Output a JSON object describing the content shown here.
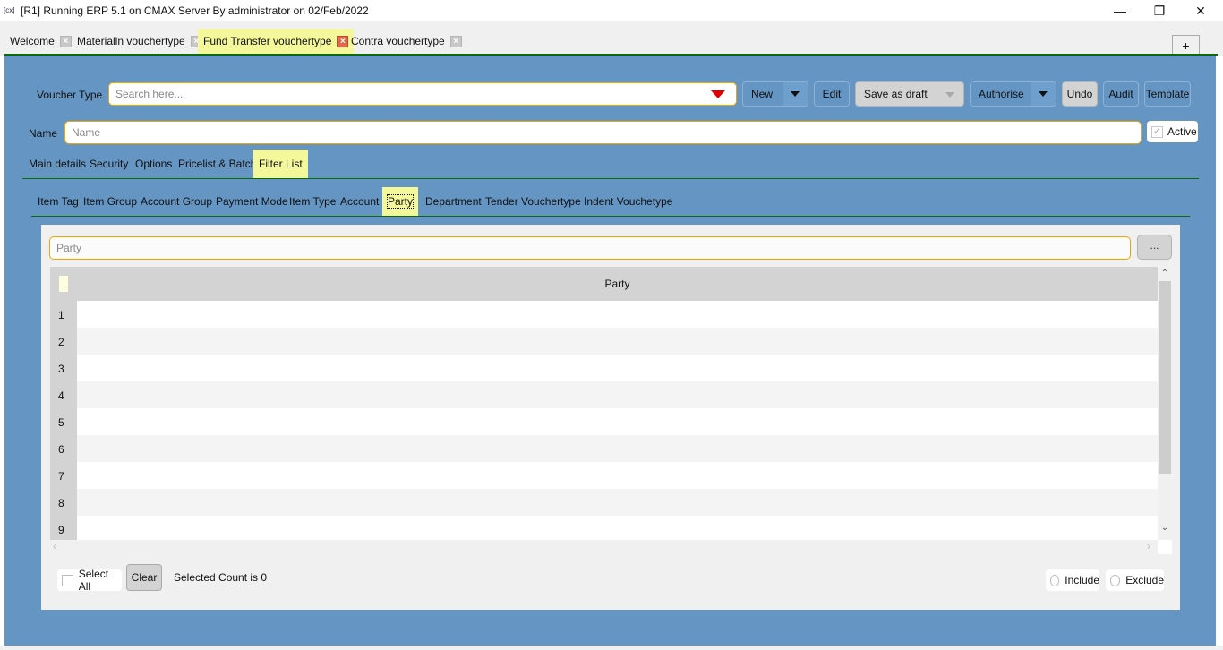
{
  "window": {
    "app_icon": "[cx]",
    "title": "[R1] Running ERP 5.1 on CMAX Server By administrator on 02/Feb/2022",
    "controls": {
      "minimize": "—",
      "restore": "❐",
      "close": "✕"
    }
  },
  "doc_tabs": [
    {
      "label": "Welcome",
      "active": false
    },
    {
      "label": "Materialln vouchertype",
      "active": false
    },
    {
      "label": "Fund Transfer vouchertype",
      "active": true
    },
    {
      "label": "Contra vouchertype",
      "active": false
    }
  ],
  "new_tab_label": "+",
  "toolbar": {
    "voucher_type_label": "Voucher Type",
    "voucher_type_placeholder": "Search here...",
    "new_label": "New",
    "edit_label": "Edit",
    "save_as_draft_label": "Save as draft",
    "authorise_label": "Authorise",
    "undo_label": "Undo",
    "audit_label": "Audit",
    "template_label": "Template"
  },
  "name_field": {
    "label": "Name",
    "placeholder": "Name"
  },
  "active_checkbox": {
    "label": "Active",
    "checked": true,
    "check_glyph": "✓"
  },
  "main_tabs": [
    {
      "label": "Main details",
      "active": false
    },
    {
      "label": "Security",
      "active": false
    },
    {
      "label": "Options",
      "active": false
    },
    {
      "label": "Pricelist & Batch",
      "active": false
    },
    {
      "label": "Filter List",
      "active": true
    }
  ],
  "filter_tabs": [
    {
      "label": "Item Tag",
      "active": false
    },
    {
      "label": "Item Group",
      "active": false
    },
    {
      "label": "Account Group",
      "active": false
    },
    {
      "label": "Payment Mode",
      "active": false
    },
    {
      "label": "Item Type",
      "active": false
    },
    {
      "label": "Account",
      "active": false
    },
    {
      "label": "Party",
      "active": true
    },
    {
      "label": "Department",
      "active": false
    },
    {
      "label": "Tender Vouchertype",
      "active": false
    },
    {
      "label": "Indent Vouchetype",
      "active": false
    }
  ],
  "party_panel": {
    "search_placeholder": "Party",
    "browse_label": "...",
    "column_header": "Party",
    "rows": [
      "1",
      "2",
      "3",
      "4",
      "5",
      "6",
      "7",
      "8",
      "9"
    ],
    "scroll_up": "⌃",
    "scroll_down": "⌄",
    "scroll_left": "‹",
    "scroll_right": "›",
    "select_all_label": "Select All",
    "clear_label": "Clear",
    "selected_count_text": "Selected Count is 0",
    "include_label": "Include",
    "exclude_label": "Exclude"
  },
  "colors": {
    "background_blue": "#6595c2",
    "active_tab_yellow": "#f4f79a",
    "input_border_orange": "#f0a500",
    "divider_green": "#0a6a0a",
    "dropdown_arrow_red": "#e00000"
  }
}
